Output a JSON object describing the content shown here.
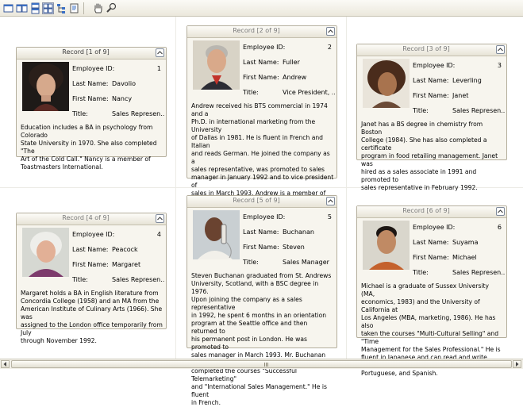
{
  "toolbar": {
    "buttons": [
      "single-record-icon",
      "two-records-icon",
      "stacked-records-icon",
      "multiple-records-icon",
      "record-tree-icon",
      "customize-icon",
      "pan-hand-icon",
      "zoom-icon"
    ]
  },
  "records": [
    {
      "header": "Record [1 of 9]",
      "labels": {
        "id": "Employee ID:",
        "last": "Last Name:",
        "first": "First Name:",
        "title": "Title:"
      },
      "employee_id": "1",
      "last_name": "Davolio",
      "first_name": "Nancy",
      "title": "Sales Represen...",
      "notes": "Education includes a BA in psychology from Colorado\nState University in 1970.  She also completed \"The\nArt of the Cold Call.\"  Nancy is a member of\nToastmasters International."
    },
    {
      "header": "Record [2 of 9]",
      "labels": {
        "id": "Employee ID:",
        "last": "Last Name:",
        "first": "First Name:",
        "title": "Title:"
      },
      "employee_id": "2",
      "last_name": "Fuller",
      "first_name": "Andrew",
      "title": "Vice President, ...",
      "notes": "Andrew received his BTS commercial in 1974 and a\nPh.D. in international marketing from the University\nof Dallas in 1981.  He is fluent in French and Italian\nand reads German.  He joined the company as a\nsales representative, was promoted to sales\nmanager in January 1992 and to vice president of\nsales in March 1993.  Andrew is a member of the\nSales Management Roundtable, the Seattle Chamber\nof Commerce, and the Pacific Rim Importers\nAssociation."
    },
    {
      "header": "Record [3 of 9]",
      "labels": {
        "id": "Employee ID:",
        "last": "Last Name:",
        "first": "First Name:",
        "title": "Title:"
      },
      "employee_id": "3",
      "last_name": "Leverling",
      "first_name": "Janet",
      "title": "Sales Represen...",
      "notes": "Janet has a BS degree in chemistry from Boston\nCollege (1984).  She has also completed a certificate\nprogram in food retailing management.  Janet was\nhired as a sales associate in 1991 and promoted to\nsales representative in February 1992."
    },
    {
      "header": "Record [4 of 9]",
      "labels": {
        "id": "Employee ID:",
        "last": "Last Name:",
        "first": "First Name:",
        "title": "Title:"
      },
      "employee_id": "4",
      "last_name": "Peacock",
      "first_name": "Margaret",
      "title": "Sales Represen...",
      "notes": "Margaret holds a BA in English literature from\nConcordia College (1958) and an MA from the\nAmerican Institute of Culinary Arts (1966).  She was\nassigned to the London office temporarily from July\nthrough November 1992."
    },
    {
      "header": "Record [5 of 9]",
      "labels": {
        "id": "Employee ID:",
        "last": "Last Name:",
        "first": "First Name:",
        "title": "Title:"
      },
      "employee_id": "5",
      "last_name": "Buchanan",
      "first_name": "Steven",
      "title": "Sales Manager",
      "notes": "Steven Buchanan graduated from St. Andrews\nUniversity, Scotland, with a BSC degree in 1976.\nUpon joining the company as a sales representative\nin 1992, he spent 6 months in an orientation\nprogram at the Seattle office and then returned to\nhis permanent post in London.  He was promoted to\nsales manager in March 1993.  Mr. Buchanan has\ncompleted the courses \"Successful Telemarketing\"\nand \"International Sales Management.\"  He is fluent\nin French."
    },
    {
      "header": "Record [6 of 9]",
      "labels": {
        "id": "Employee ID:",
        "last": "Last Name:",
        "first": "First Name:",
        "title": "Title:"
      },
      "employee_id": "6",
      "last_name": "Suyama",
      "first_name": "Michael",
      "title": "Sales Represen...",
      "notes": "Michael is a graduate of Sussex University (MA,\neconomics, 1983) and the University of California at\nLos Angeles (MBA, marketing, 1986).  He has also\ntaken the courses \"Multi-Cultural Selling\" and \"Time\nManagement for the Sales Professional.\"  He is\nfluent in Japanese and can read and write French,\nPortuguese, and Spanish."
    }
  ],
  "scrollbar": {
    "position": 0
  }
}
